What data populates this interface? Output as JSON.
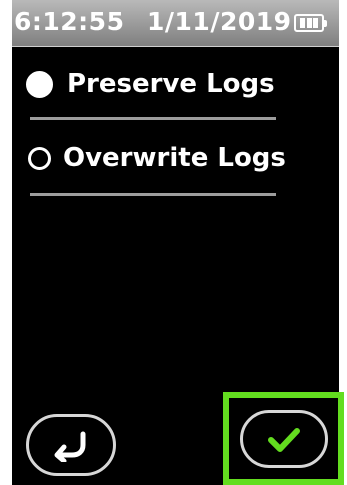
{
  "status_bar": {
    "time": "6:12:55",
    "date": "1/11/2019",
    "battery_icon": "battery-icon"
  },
  "options": [
    {
      "label": "Preserve Logs",
      "selected": true,
      "icon": "radio-selected-icon"
    },
    {
      "label": "Overwrite Logs",
      "selected": false,
      "icon": "radio-unselected-icon"
    }
  ],
  "footer": {
    "back_icon": "back-arrow-icon",
    "confirm_icon": "checkmark-icon",
    "confirm_highlight_color": "#63dd1f",
    "checkmark_color": "#63dd1f"
  },
  "colors": {
    "screen_background": "#000000",
    "status_bar_background": "#9a9a9a",
    "text": "#ffffff",
    "divider": "#9d9d9d"
  }
}
